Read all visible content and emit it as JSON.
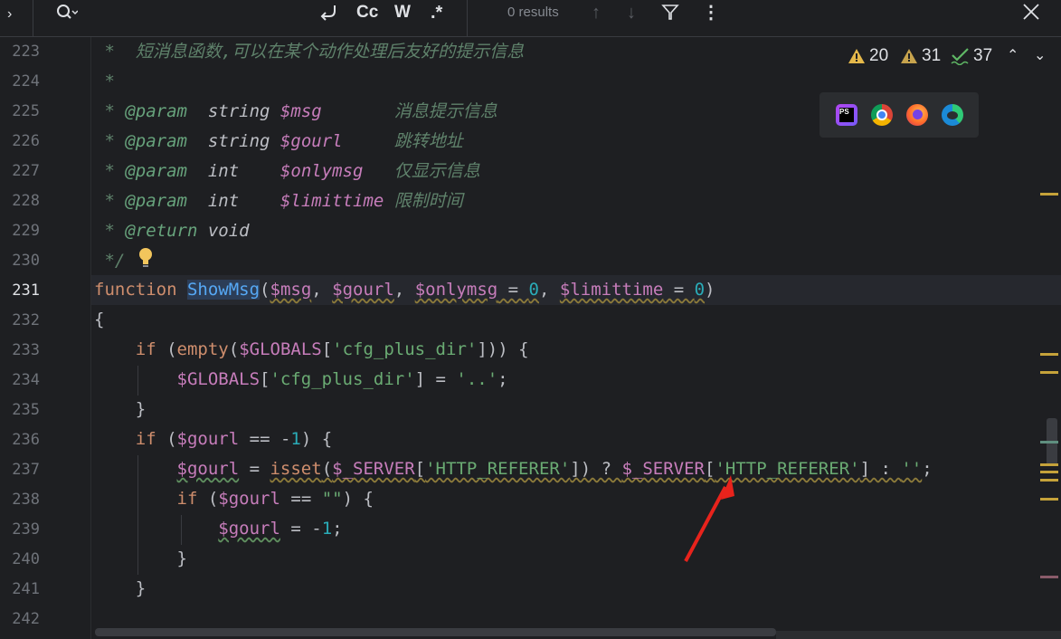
{
  "search_toolbar": {
    "results_text": "0 results",
    "match_case_label": "Cc",
    "whole_words_label": "W",
    "regex_label": ".*"
  },
  "inspections": {
    "errors": "20",
    "warnings": "31",
    "typos": "37"
  },
  "browsers": [
    "phpstorm-icon",
    "chrome-icon",
    "firefox-icon",
    "edge-icon"
  ],
  "line_numbers": [
    "223",
    "224",
    "225",
    "226",
    "227",
    "228",
    "229",
    "230",
    "231",
    "232",
    "233",
    "234",
    "235",
    "236",
    "237",
    "238",
    "239",
    "240",
    "241",
    "242"
  ],
  "code": {
    "l223": {
      "star": " *  ",
      "text": "短消息函数,可以在某个动作处理后友好的提示信息"
    },
    "l224": {
      "star": " *"
    },
    "l225": {
      "star": " * ",
      "tag": "@param",
      "type": "string",
      "var": "$msg",
      "desc": "消息提示信息"
    },
    "l226": {
      "star": " * ",
      "tag": "@param",
      "type": "string",
      "var": "$gourl",
      "desc": "跳转地址"
    },
    "l227": {
      "star": " * ",
      "tag": "@param",
      "type": "int",
      "var": "$onlymsg",
      "desc": "仅显示信息"
    },
    "l228": {
      "star": " * ",
      "tag": "@param",
      "type": "int",
      "var": "$limittime",
      "desc": "限制时间"
    },
    "l229": {
      "star": " * ",
      "tag": "@return",
      "type": "void"
    },
    "l230": {
      "text": " */"
    },
    "l231": {
      "kw": "function",
      "fn": "ShowMsg",
      "p1": "$msg",
      "p2": "$gourl",
      "p3": "$onlymsg",
      "p4": "$limittime",
      "zero": "0"
    },
    "l232": {
      "text": "{"
    },
    "l233": {
      "kw": "if",
      "fn": "empty",
      "var": "$GLOBALS",
      "str": "'cfg_plus_dir'"
    },
    "l234": {
      "var": "$GLOBALS",
      "str": "'cfg_plus_dir'",
      "str2": "'..'"
    },
    "l235": {
      "text": "}"
    },
    "l236": {
      "kw": "if",
      "var": "$gourl",
      "num": "1"
    },
    "l237": {
      "var": "$gourl",
      "fn": "isset",
      "srv": "$_SERVER",
      "str": "'HTTP_REFERER'",
      "empty": "''"
    },
    "l238": {
      "kw": "if",
      "var": "$gourl",
      "str": "\"\""
    },
    "l239": {
      "var": "$gourl",
      "num": "1"
    },
    "l240": {
      "text": "}"
    },
    "l241": {
      "text": "}"
    }
  }
}
